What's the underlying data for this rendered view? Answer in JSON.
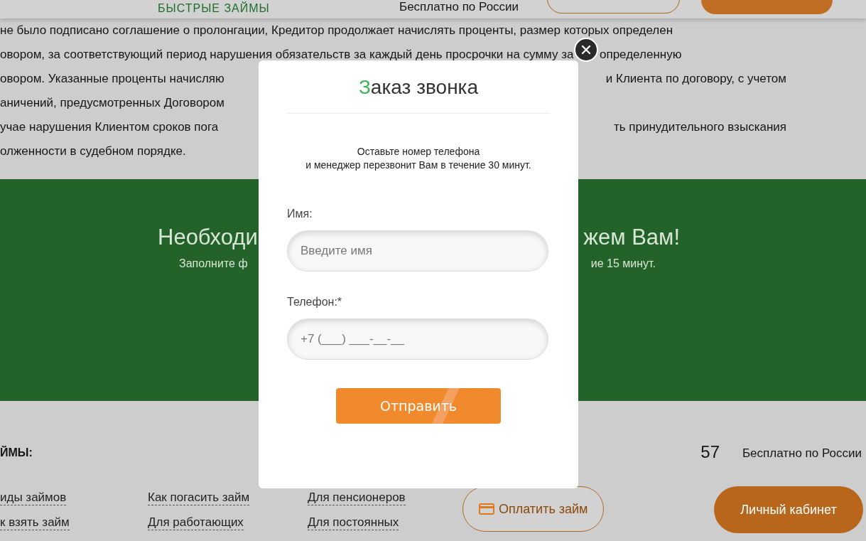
{
  "header": {
    "logo": "БЫСТРЫЕ ЗАЙМЫ",
    "note": "Бесплатно по России"
  },
  "article": {
    "lines": [
      {
        "left": "не было подписано соглашение о пролонгации, Кредитор продолжает начислять проценты, размер которых определен"
      },
      {
        "left": "овором, за соответствующий период нарушения обязательств за каждый день просрочки на сумму за",
        "right": "определенную"
      },
      {
        "left": "овором. Указанные проценты начисляю",
        "right": "и Клиента по договору, с учетом"
      },
      {
        "left": "аничений, предусмотренных Договором"
      },
      {
        "left": "учае нарушения Клиентом сроков пога",
        "right": "ть принудительного взыскания"
      },
      {
        "left": "олженности в судебном порядке."
      }
    ]
  },
  "banner": {
    "heading_left": "Необходи",
    "heading_right": "жем Вам!",
    "sub_left": "Заполните ф",
    "sub_right": "ие 15 минут."
  },
  "footer": {
    "heading": "ЙМЫ:",
    "phone": "57",
    "note": "Бесплатно по России",
    "link_columns": [
      [
        "иды займов",
        "к взять займ"
      ],
      [
        "Как погасить займ",
        "Для работающих"
      ],
      [
        "Для пенсионеров",
        "Для постоянных"
      ]
    ],
    "pay_button": "Оплатить займ",
    "cabinet_button": "Личный кабинет"
  },
  "modal": {
    "title_accent": "З",
    "title_rest": "аказ звонка",
    "description": [
      "Оставьте номер телефона",
      "и менеджер перезвонит Вам в течение 30 минут."
    ],
    "fields": [
      {
        "label": "Имя:",
        "placeholder": "Введите имя"
      },
      {
        "label": "Телефон:*",
        "placeholder": "+7 (___) ___-__-__"
      }
    ],
    "submit": "Отправить"
  }
}
